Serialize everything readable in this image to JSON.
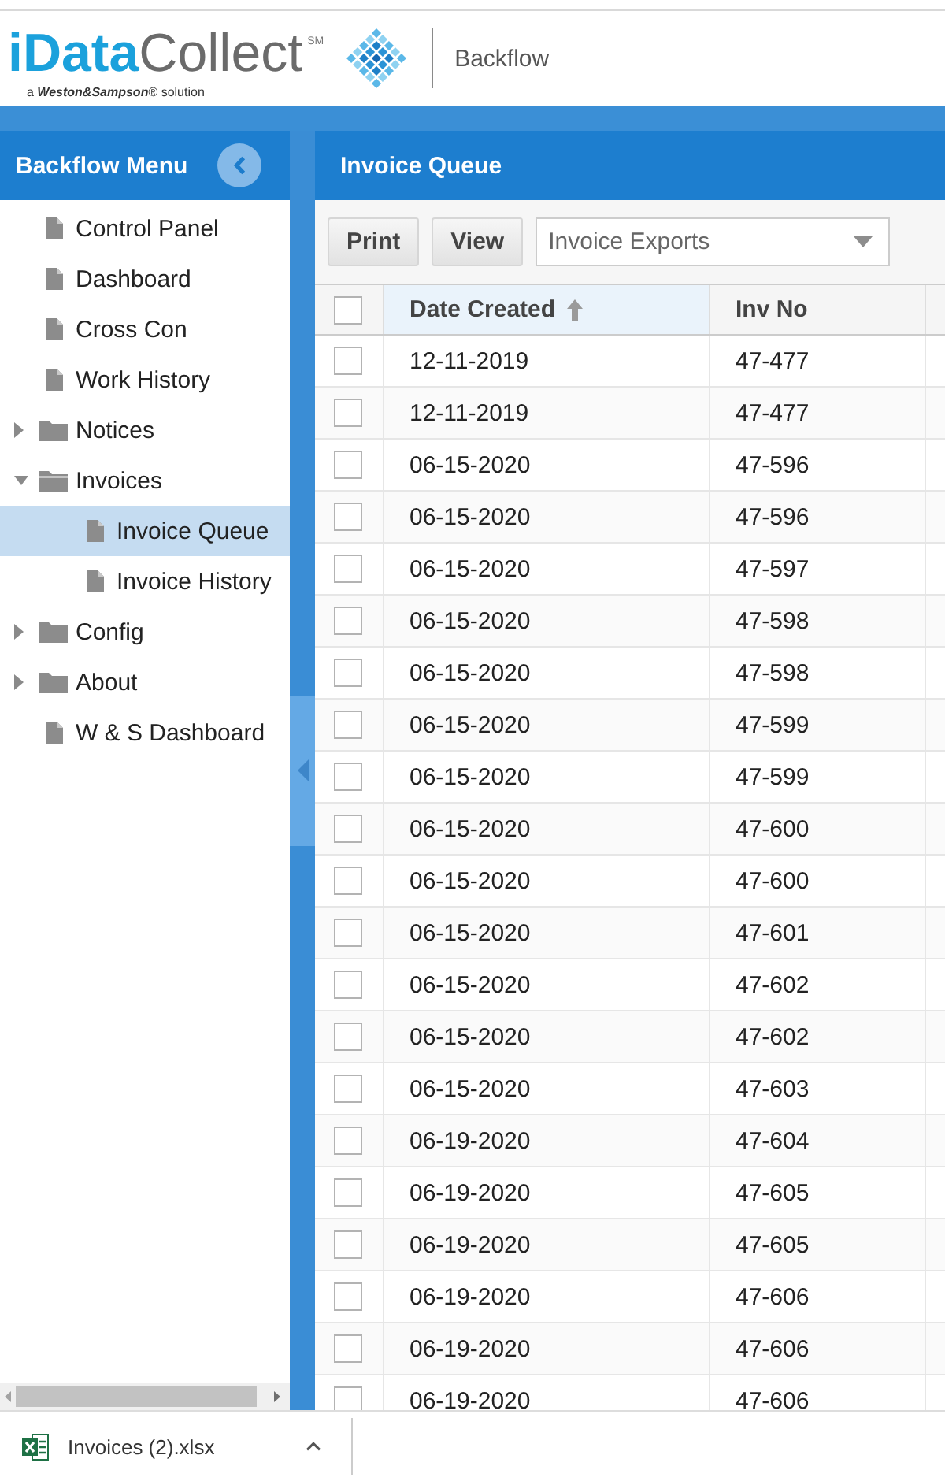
{
  "header": {
    "logo": {
      "wordmark": "**iData**Collect$^{SM}$",
      "tagline": "a **Weston&Sampson**® solution"
    },
    "app_name": "Backflow"
  },
  "sidebar": {
    "title": "Backflow Menu",
    "items": [
      {
        "label": "Control Panel",
        "kind": "page",
        "selected": false
      },
      {
        "label": "Dashboard",
        "kind": "page",
        "selected": false
      },
      {
        "label": "Cross Con",
        "kind": "page",
        "selected": false
      },
      {
        "label": "Work History",
        "kind": "page",
        "selected": false
      },
      {
        "label": "Notices",
        "kind": "folder",
        "expanded": false,
        "selected": false
      },
      {
        "label": "Invoices",
        "kind": "folder",
        "expanded": true,
        "selected": false,
        "children": [
          {
            "label": "Invoice Queue",
            "kind": "page",
            "selected": true
          },
          {
            "label": "Invoice History",
            "kind": "page",
            "selected": false
          }
        ]
      },
      {
        "label": "Config",
        "kind": "folder",
        "expanded": false,
        "selected": false
      },
      {
        "label": "About",
        "kind": "folder",
        "expanded": false,
        "selected": false
      },
      {
        "label": "W & S Dashboard",
        "kind": "page",
        "selected": false
      }
    ]
  },
  "panel": {
    "title": "Invoice Queue",
    "toolbar": {
      "buttons": [
        {
          "label": "Print"
        },
        {
          "label": "View"
        }
      ],
      "dropdown": {
        "value": "Invoice Exports"
      }
    },
    "table": {
      "select_all": {
        "checked": false
      },
      "columns": [
        {
          "label": "Date Created",
          "sorted": true
        },
        {
          "label": "Inv No",
          "sorted": false
        }
      ],
      "rows": [
        {
          "checked": false,
          "cells": [
            "12-11-2019",
            "47-477"
          ]
        },
        {
          "checked": false,
          "cells": [
            "12-11-2019",
            "47-477"
          ]
        },
        {
          "checked": false,
          "cells": [
            "06-15-2020",
            "47-596"
          ]
        },
        {
          "checked": false,
          "cells": [
            "06-15-2020",
            "47-596"
          ]
        },
        {
          "checked": false,
          "cells": [
            "06-15-2020",
            "47-597"
          ]
        },
        {
          "checked": false,
          "cells": [
            "06-15-2020",
            "47-598"
          ]
        },
        {
          "checked": false,
          "cells": [
            "06-15-2020",
            "47-598"
          ]
        },
        {
          "checked": false,
          "cells": [
            "06-15-2020",
            "47-599"
          ]
        },
        {
          "checked": false,
          "cells": [
            "06-15-2020",
            "47-599"
          ]
        },
        {
          "checked": false,
          "cells": [
            "06-15-2020",
            "47-600"
          ]
        },
        {
          "checked": false,
          "cells": [
            "06-15-2020",
            "47-600"
          ]
        },
        {
          "checked": false,
          "cells": [
            "06-15-2020",
            "47-601"
          ]
        },
        {
          "checked": false,
          "cells": [
            "06-15-2020",
            "47-602"
          ]
        },
        {
          "checked": false,
          "cells": [
            "06-15-2020",
            "47-602"
          ]
        },
        {
          "checked": false,
          "cells": [
            "06-15-2020",
            "47-603"
          ]
        },
        {
          "checked": false,
          "cells": [
            "06-19-2020",
            "47-604"
          ]
        },
        {
          "checked": false,
          "cells": [
            "06-19-2020",
            "47-605"
          ]
        },
        {
          "checked": false,
          "cells": [
            "06-19-2020",
            "47-605"
          ]
        },
        {
          "checked": false,
          "cells": [
            "06-19-2020",
            "47-606"
          ]
        },
        {
          "checked": false,
          "cells": [
            "06-19-2020",
            "47-606"
          ]
        },
        {
          "checked": false,
          "cells": [
            "06-19-2020",
            "47-606"
          ]
        }
      ]
    }
  },
  "download_bar": {
    "file_name": "Invoices (2).xlsx"
  }
}
